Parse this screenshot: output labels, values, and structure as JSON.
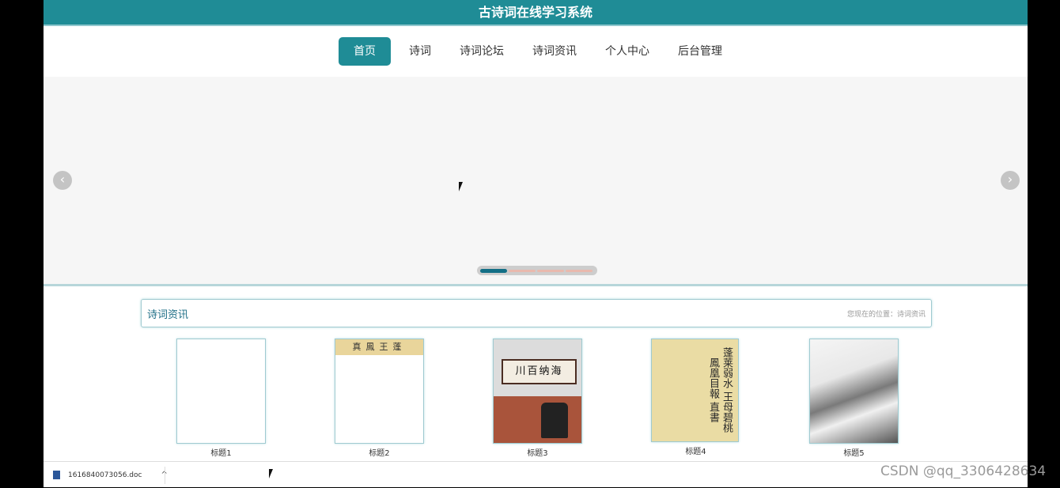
{
  "app": {
    "title": "古诗词在线学习系统"
  },
  "nav": {
    "items": [
      {
        "label": "首页"
      },
      {
        "label": "诗词"
      },
      {
        "label": "诗词论坛"
      },
      {
        "label": "诗词资讯"
      },
      {
        "label": "个人中心"
      },
      {
        "label": "后台管理"
      }
    ],
    "active": "首页"
  },
  "banner": {
    "prev_icon": "chevron-left-icon",
    "next_icon": "chevron-right-icon",
    "slides": 4,
    "active_slide": 1
  },
  "section": {
    "title": "诗词资讯",
    "breadcrumb": "您现在的位置：诗词资讯"
  },
  "cards": [
    {
      "label": "标题1"
    },
    {
      "label": "标题2",
      "image_text": "真鳳王蓬"
    },
    {
      "label": "标题3",
      "image_text": "川百纳海"
    },
    {
      "label": "标题4",
      "image_text": "蓬莱弱水 王母碧桃 鳳凰目報 直書"
    },
    {
      "label": "标题5"
    }
  ],
  "download": {
    "filename": "1616840073056.doc"
  },
  "watermark": "CSDN @qq_3306428634",
  "colors": {
    "accent": "#1f8c96",
    "nav_active": "#1f8c96",
    "section_title": "#1f6f87"
  }
}
